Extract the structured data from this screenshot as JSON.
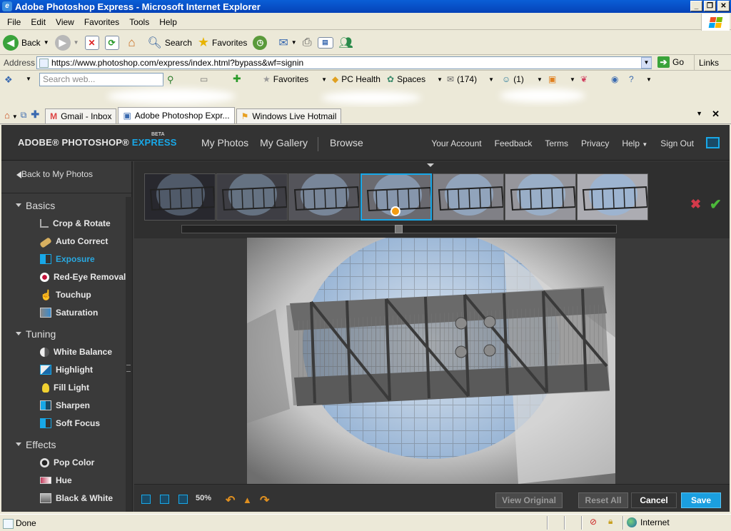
{
  "window": {
    "title": "Adobe Photoshop Express - Microsoft Internet Explorer"
  },
  "menu": [
    "File",
    "Edit",
    "View",
    "Favorites",
    "Tools",
    "Help"
  ],
  "toolbar": {
    "back": "Back",
    "search": "Search",
    "favorites": "Favorites"
  },
  "address": {
    "label": "Address",
    "url": "https://www.photoshop.com/express/index.html?bypass&wf=signin",
    "go": "Go",
    "links": "Links"
  },
  "live": {
    "search_placeholder": "Search web...",
    "favorites": "Favorites",
    "pc_health": "PC Health",
    "spaces": "Spaces",
    "mail_count": "(174)",
    "messenger_count": "(1)"
  },
  "tabs": [
    {
      "label": "Gmail - Inbox"
    },
    {
      "label": "Adobe Photoshop Expr..."
    },
    {
      "label": "Windows Live Hotmail"
    }
  ],
  "app": {
    "brand_prefix": "ADOBE® PHOTOSHOP®",
    "brand_express": "EXPRESS",
    "beta": "BETA",
    "nav": [
      "My Photos",
      "My Gallery",
      "Browse"
    ],
    "right_nav": [
      "Your Account",
      "Feedback",
      "Terms",
      "Privacy",
      "Help",
      "Sign Out"
    ],
    "back": "Back to My Photos",
    "sections": [
      {
        "label": "Basics",
        "tools": [
          "Crop & Rotate",
          "Auto Correct",
          "Exposure",
          "Red-Eye Removal",
          "Touchup",
          "Saturation"
        ]
      },
      {
        "label": "Tuning",
        "tools": [
          "White Balance",
          "Highlight",
          "Fill Light",
          "Sharpen",
          "Soft Focus"
        ]
      },
      {
        "label": "Effects",
        "tools": [
          "Pop Color",
          "Hue",
          "Black & White"
        ]
      }
    ],
    "selected_tool": "Exposure",
    "thumb_count": 7,
    "selected_thumb_index": 3,
    "exposure_slider_value": 0.5,
    "zoom": "50%",
    "buttons": {
      "view_original": "View Original",
      "reset_all": "Reset All",
      "cancel": "Cancel",
      "save": "Save"
    }
  },
  "status": {
    "text": "Done",
    "zone": "Internet"
  },
  "colors": {
    "accent": "#18a8e8",
    "save": "#1b9fe0",
    "xp_title": "#0a5fd6"
  }
}
